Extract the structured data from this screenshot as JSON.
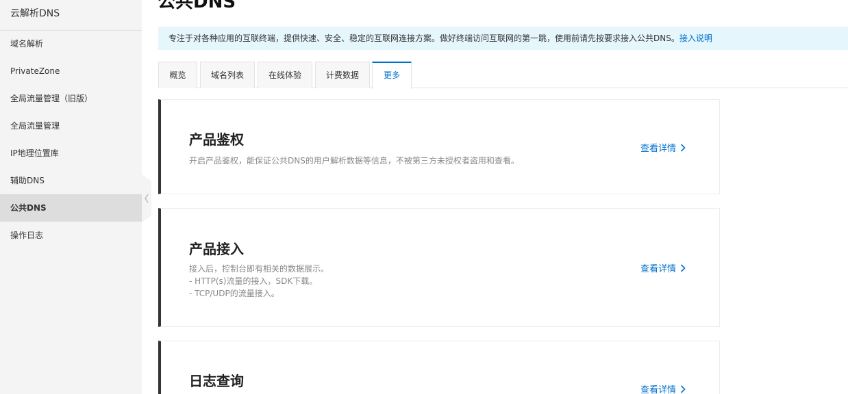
{
  "sidebar": {
    "title": "云解析DNS",
    "items": [
      {
        "label": "域名解析"
      },
      {
        "label": "PrivateZone"
      },
      {
        "label": "全局流量管理（旧版）"
      },
      {
        "label": "全局流量管理"
      },
      {
        "label": "IP地理位置库"
      },
      {
        "label": "辅助DNS"
      },
      {
        "label": "公共DNS",
        "active": true
      },
      {
        "label": "操作日志"
      }
    ]
  },
  "page": {
    "title": "公共DNS"
  },
  "notice": {
    "text": "专注于对各种应用的互联终端，提供快速、安全、稳定的互联网连接方案。做好终端访问互联网的第一跳，使用前请先按要求接入公共DNS。",
    "link": "接入说明"
  },
  "tabs": [
    {
      "label": "概览"
    },
    {
      "label": "域名列表"
    },
    {
      "label": "在线体验"
    },
    {
      "label": "计费数据"
    },
    {
      "label": "更多",
      "active": true
    }
  ],
  "cards": [
    {
      "title": "产品鉴权",
      "desc": [
        "开启产品鉴权，能保证公共DNS的用户解析数据等信息，不被第三方未授权者盗用和查看。"
      ],
      "link": "查看详情"
    },
    {
      "title": "产品接入",
      "desc": [
        "接入后，控制台即有相关的数据展示。",
        "- HTTP(s)流量的接入，SDK下载。",
        "- TCP/UDP的流量接入。"
      ],
      "link": "查看详情"
    },
    {
      "title": "日志查询",
      "desc": [],
      "link": "查看详情"
    }
  ],
  "colors": {
    "accent": "#0070cc",
    "notice_bg": "#e5f6fd",
    "sidebar_bg": "#f4f4f4",
    "sidebar_active_bg": "#dddddd"
  },
  "icons": {
    "collapse": "chevron-left-icon",
    "card_link": "chevron-right-icon"
  }
}
